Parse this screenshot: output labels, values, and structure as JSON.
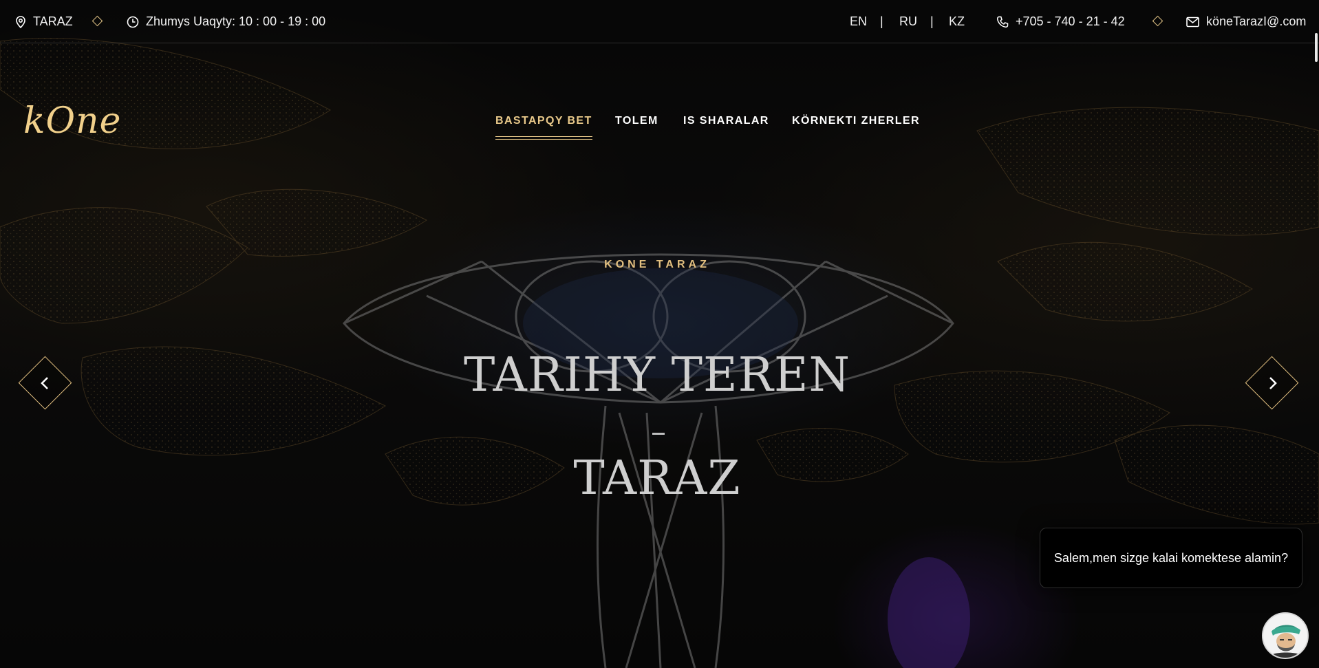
{
  "topbar": {
    "location": "TARAZ",
    "hours": "Zhumys Uaqyty: 10 : 00 - 19 : 00",
    "languages": [
      "EN",
      "RU",
      "KZ"
    ],
    "lang_separator": "|",
    "phone": "+705 - 740 - 21 - 42",
    "email": "köneTarazI@.com",
    "icons": [
      "map-pin-icon",
      "clock-icon",
      "phone-icon",
      "mail-icon"
    ],
    "accent_color": "#e8c98a"
  },
  "logo": {
    "text": "kOne"
  },
  "nav": {
    "items": [
      {
        "label": "BASTAPQY BET",
        "active": true
      },
      {
        "label": "TOLEM",
        "active": false
      },
      {
        "label": "IS SHARALAR",
        "active": false
      },
      {
        "label": "KÖRNEKTI ZHERLER",
        "active": false
      }
    ]
  },
  "hero": {
    "subtitle": "KONE TARAZ",
    "title_line1": "TARIHY TEREN",
    "title_line2": "TARAZ",
    "prev_icon": "chevron-left-icon",
    "next_icon": "chevron-right-icon"
  },
  "chat": {
    "message": "Salem,men sizge kalai komektese alamin?",
    "avatar_icon": "assistant-avatar-icon"
  }
}
